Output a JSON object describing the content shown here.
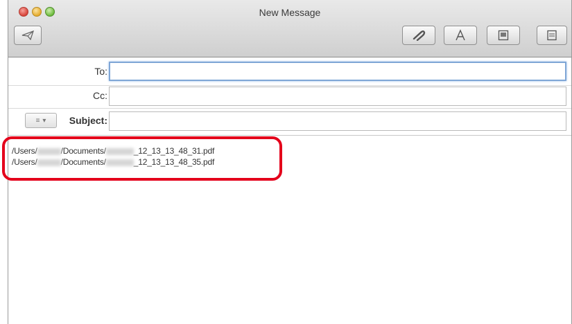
{
  "window": {
    "title": "New Message"
  },
  "headers": {
    "to_label": "To:",
    "cc_label": "Cc:",
    "subject_label": "Subject:",
    "to_value": "",
    "cc_value": "",
    "subject_value": ""
  },
  "toolbar": {
    "icons": [
      "send-icon",
      "paperclip-icon",
      "font-icon",
      "photo-browser-icon",
      "stationery-icon"
    ]
  },
  "body": {
    "lines": [
      {
        "prefix": "/Users/",
        "mid": "/Documents/",
        "suffix": "_12_13_13_48_31.pdf"
      },
      {
        "prefix": "/Users/",
        "mid": "/Documents/",
        "suffix": "_12_13_13_48_35.pdf"
      }
    ]
  },
  "colors": {
    "highlight": "#e4001b",
    "focus_ring": "#7fa6d6"
  }
}
